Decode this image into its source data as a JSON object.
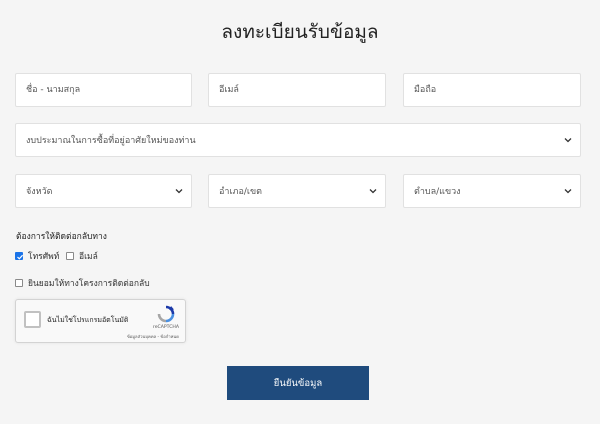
{
  "form": {
    "title": "ลงทะเบียนรับข้อมูล",
    "fields": {
      "name_placeholder": "ชื่อ - นามสกุล",
      "email_placeholder": "อีเมล์",
      "phone_placeholder": "มือถือ"
    },
    "budget_select": {
      "selected": "งบประมาณในการซื้อที่อยู่อาศัยใหม่ของท่าน",
      "icon": "chevron-down-icon"
    },
    "province_select": {
      "selected": "จังหวัด",
      "icon": "chevron-down-icon"
    },
    "district_select": {
      "selected": "อำเภอ/เขต",
      "icon": "chevron-down-icon"
    },
    "subdistrict_select": {
      "selected": "ตำบล/แขวง",
      "icon": "chevron-down-icon"
    },
    "contact_label": "ต้องการให้ติดต่อกลับทาง",
    "contact_options": [
      {
        "label": "โทรศัพท์",
        "checked": true
      },
      {
        "label": "อีเมล์",
        "checked": false
      }
    ],
    "consent": {
      "label": "ยินยอมให้ทางโครงการติดต่อกลับ",
      "checked": false
    },
    "recaptcha": {
      "label": "ฉันไม่ใช่โปรแกรมอัตโนมัติ",
      "brand": "reCAPTCHA",
      "links": "ข้อมูลส่วนบุคคล - ข้อกำหนด"
    },
    "submit_label": "ยืนยันข้อมูล"
  },
  "colors": {
    "background": "#f5f5f5",
    "input_border": "#e1e1e1",
    "submit_bg": "#1f4b7d",
    "checkbox_checked": "#1a73e8"
  }
}
